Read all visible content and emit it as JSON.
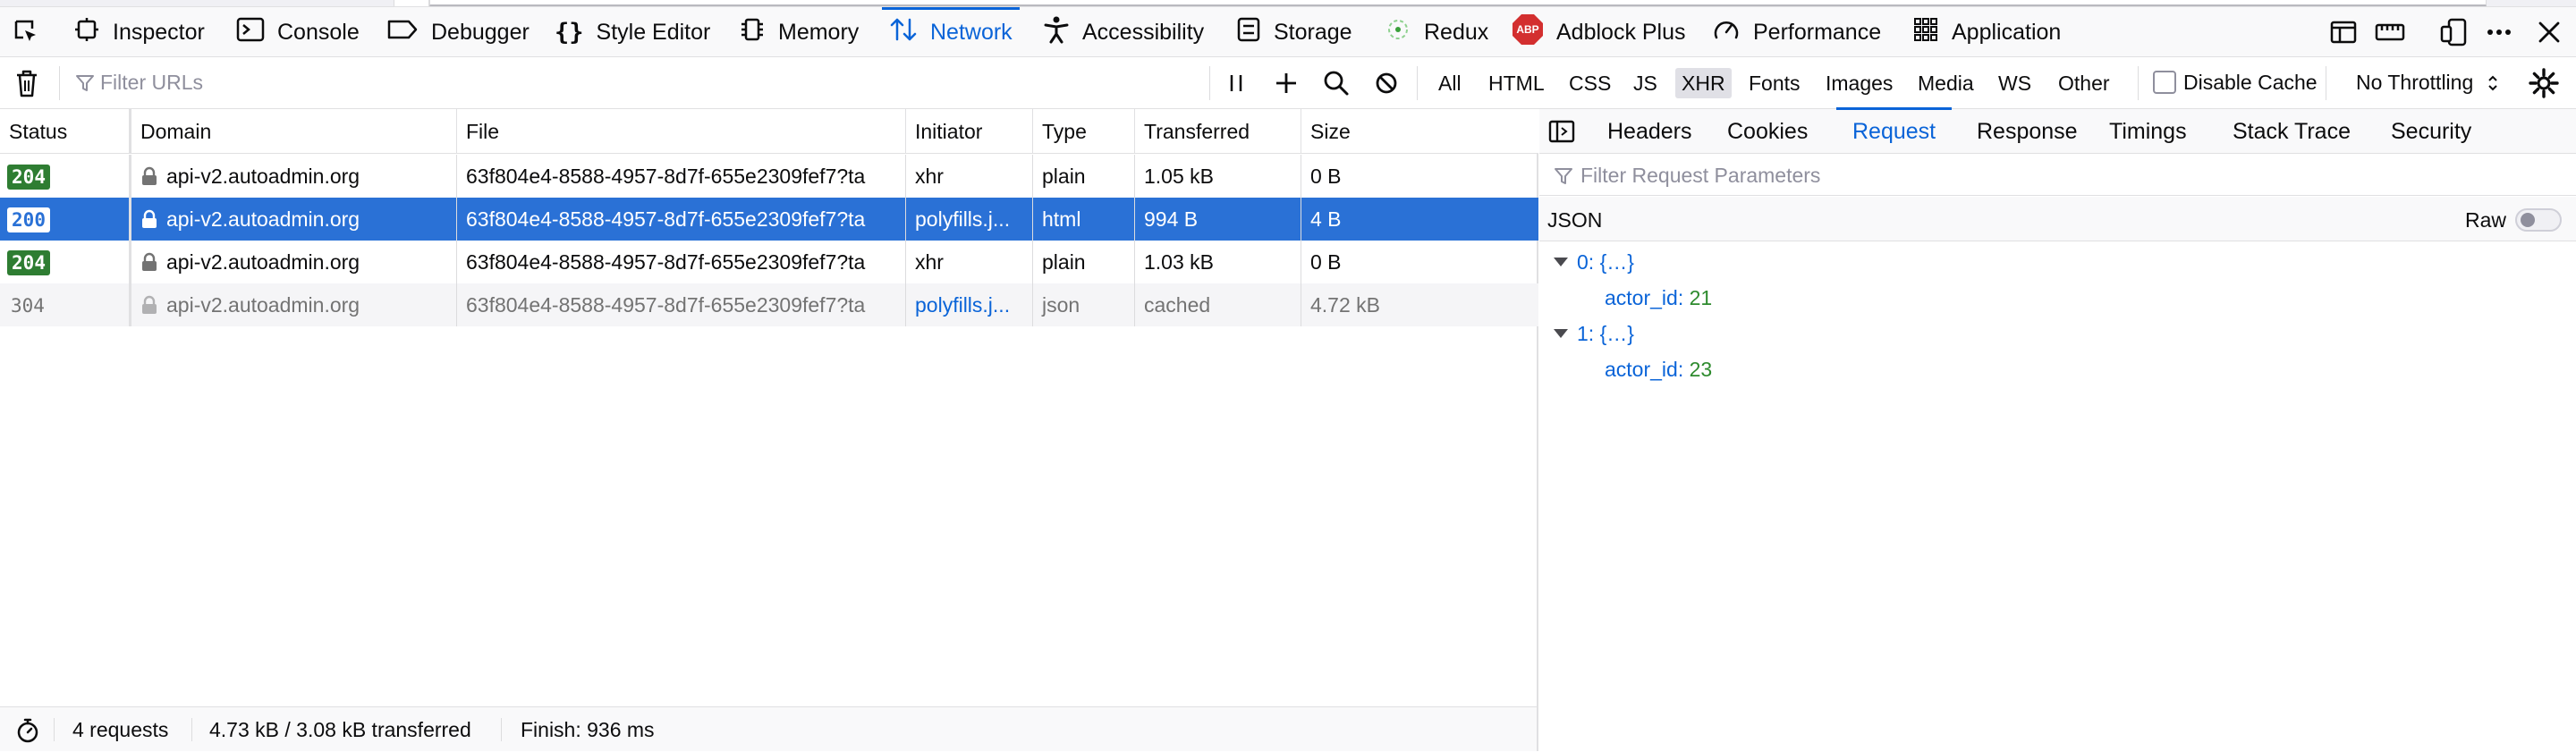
{
  "toolbox": {
    "tools": [
      {
        "label": "Inspector",
        "icon": "inspector-icon"
      },
      {
        "label": "Console",
        "icon": "console-icon"
      },
      {
        "label": "Debugger",
        "icon": "debugger-icon"
      },
      {
        "label": "Style Editor",
        "icon": "style-editor-icon"
      },
      {
        "label": "Memory",
        "icon": "memory-icon"
      },
      {
        "label": "Network",
        "icon": "network-icon",
        "selected": true
      },
      {
        "label": "Accessibility",
        "icon": "accessibility-icon"
      },
      {
        "label": "Storage",
        "icon": "storage-icon"
      },
      {
        "label": "Redux",
        "icon": "redux-icon"
      },
      {
        "label": "Adblock Plus",
        "icon": "adblock-plus-icon",
        "icon_text": "ABP"
      },
      {
        "label": "Performance",
        "icon": "performance-icon"
      },
      {
        "label": "Application",
        "icon": "application-icon"
      }
    ],
    "accent": "#0a64d8"
  },
  "toolbar": {
    "filter_placeholder": "Filter URLs",
    "type_filters": [
      "All",
      "HTML",
      "CSS",
      "JS",
      "XHR",
      "Fonts",
      "Images",
      "Media",
      "WS",
      "Other"
    ],
    "active_type_filter": "XHR",
    "disable_cache_label": "Disable Cache",
    "disable_cache_checked": false,
    "throttling": "No Throttling"
  },
  "table": {
    "columns": [
      "Status",
      "Domain",
      "File",
      "Initiator",
      "Type",
      "Transferred",
      "Size"
    ],
    "rows": [
      {
        "status": "204",
        "domain": "api-v2.autoadmin.org",
        "file": "63f804e4-8588-4957-8d7f-655e2309fef7?ta",
        "initiator": "xhr",
        "type": "plain",
        "transferred": "1.05 kB",
        "size": "0 B"
      },
      {
        "status": "200",
        "domain": "api-v2.autoadmin.org",
        "file": "63f804e4-8588-4957-8d7f-655e2309fef7?ta",
        "initiator": "polyfills.j...",
        "type": "html",
        "transferred": "994 B",
        "size": "4 B",
        "selected": true
      },
      {
        "status": "204",
        "domain": "api-v2.autoadmin.org",
        "file": "63f804e4-8588-4957-8d7f-655e2309fef7?ta",
        "initiator": "xhr",
        "type": "plain",
        "transferred": "1.03 kB",
        "size": "0 B"
      },
      {
        "status": "304",
        "domain": "api-v2.autoadmin.org",
        "file": "63f804e4-8588-4957-8d7f-655e2309fef7?ta",
        "initiator": "polyfills.j...",
        "type": "json",
        "transferred": "cached",
        "size": "4.72 kB"
      }
    ],
    "colors": {
      "status_ok": "#2e7d32",
      "selected_row": "#2a71d6"
    }
  },
  "footer": {
    "requests": "4 requests",
    "transferred": "4.73 kB / 3.08 kB transferred",
    "finish": "Finish: 936 ms"
  },
  "side": {
    "tabs": [
      "Headers",
      "Cookies",
      "Request",
      "Response",
      "Timings",
      "Stack Trace",
      "Security"
    ],
    "active_tab": "Request",
    "filter_placeholder": "Filter Request Parameters",
    "json_label": "JSON",
    "raw_label": "Raw",
    "raw_enabled": false,
    "tree": [
      {
        "index": "0:",
        "summary": "{…}",
        "key": "actor_id:",
        "value": "21"
      },
      {
        "index": "1:",
        "summary": "{…}",
        "key": "actor_id:",
        "value": "23"
      }
    ]
  }
}
